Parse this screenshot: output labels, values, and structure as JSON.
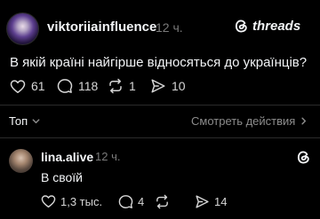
{
  "post": {
    "username": "viktoriiainfluence",
    "time": "12 ч.",
    "brand": "threads",
    "text": "В якій країні найгірше відносяться до українців?",
    "likes": "61",
    "replies": "118",
    "reposts": "1",
    "shares": "10"
  },
  "sort": {
    "label": "Топ",
    "activity_link": "Смотреть действия"
  },
  "reply": {
    "username": "lina.alive",
    "time": "12 ч.",
    "text": "В своїй",
    "likes": "1,3 тыс.",
    "replies": "4",
    "reposts": "",
    "shares": "14"
  },
  "colors": {
    "background": "#000000",
    "text": "#f3f5f7",
    "muted": "#7a7a7a",
    "divider": "#2b2b2b"
  }
}
